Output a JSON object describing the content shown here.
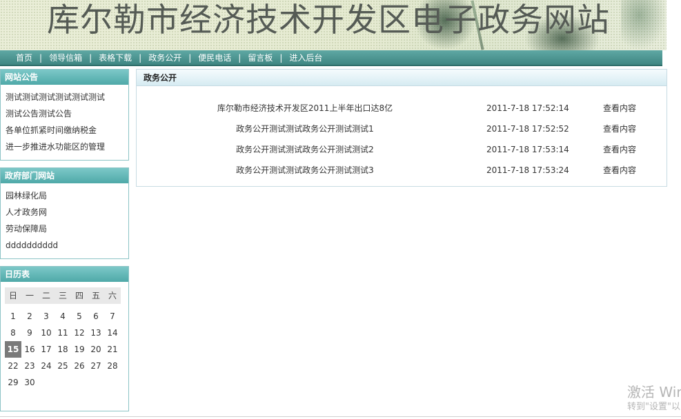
{
  "site": {
    "title": "库尔勒市经济技术开发区电子政务网站"
  },
  "nav": {
    "items": [
      {
        "label": "首页"
      },
      {
        "label": "领导信箱"
      },
      {
        "label": "表格下载"
      },
      {
        "label": "政务公开"
      },
      {
        "label": "便民电话"
      },
      {
        "label": "留言板"
      },
      {
        "label": "进入后台"
      }
    ],
    "separator": "|"
  },
  "announcements": {
    "title": "网站公告",
    "items": [
      {
        "label": "测试测试测试测试测试测试"
      },
      {
        "label": "测试公告测试公告"
      },
      {
        "label": "各单位抓紧时间缴纳税金"
      },
      {
        "label": "进一步推进水功能区的管理"
      }
    ]
  },
  "departments": {
    "title": "政府部门网站",
    "items": [
      {
        "label": "园林绿化局"
      },
      {
        "label": "人才政务网"
      },
      {
        "label": "劳动保障局"
      },
      {
        "label": "dddddddddd"
      }
    ]
  },
  "calendar": {
    "title": "日历表",
    "weekdays": [
      "日",
      "一",
      "二",
      "三",
      "四",
      "五",
      "六"
    ],
    "weeks": [
      [
        "1",
        "2",
        "3",
        "4",
        "5",
        "6",
        "7"
      ],
      [
        "8",
        "9",
        "10",
        "11",
        "12",
        "13",
        "14"
      ],
      [
        "15",
        "16",
        "17",
        "18",
        "19",
        "20",
        "21"
      ],
      [
        "22",
        "23",
        "24",
        "25",
        "26",
        "27",
        "28"
      ],
      [
        "29",
        "30",
        "",
        "",
        "",
        "",
        ""
      ]
    ],
    "today": "15"
  },
  "main": {
    "title": "政务公开",
    "rows": [
      {
        "title": "库尔勒市经济技术开发区2011上半年出口达8亿",
        "date": "2011-7-18 17:52:14",
        "link": "查看内容"
      },
      {
        "title": "政务公开测试测试政务公开测试测试1",
        "date": "2011-7-18 17:52:52",
        "link": "查看内容"
      },
      {
        "title": "政务公开测试测试政务公开测试测试2",
        "date": "2011-7-18 17:53:14",
        "link": "查看内容"
      },
      {
        "title": "政务公开测试测试政务公开测试测试3",
        "date": "2011-7-18 17:53:24",
        "link": "查看内容"
      }
    ]
  },
  "watermark": {
    "line1": "激活 Wir",
    "line2": "转到\"设置\"以"
  },
  "colors": {
    "nav": "#4f9a96",
    "panel_head": "#5fb3b3",
    "today": "#7a7a7a"
  }
}
